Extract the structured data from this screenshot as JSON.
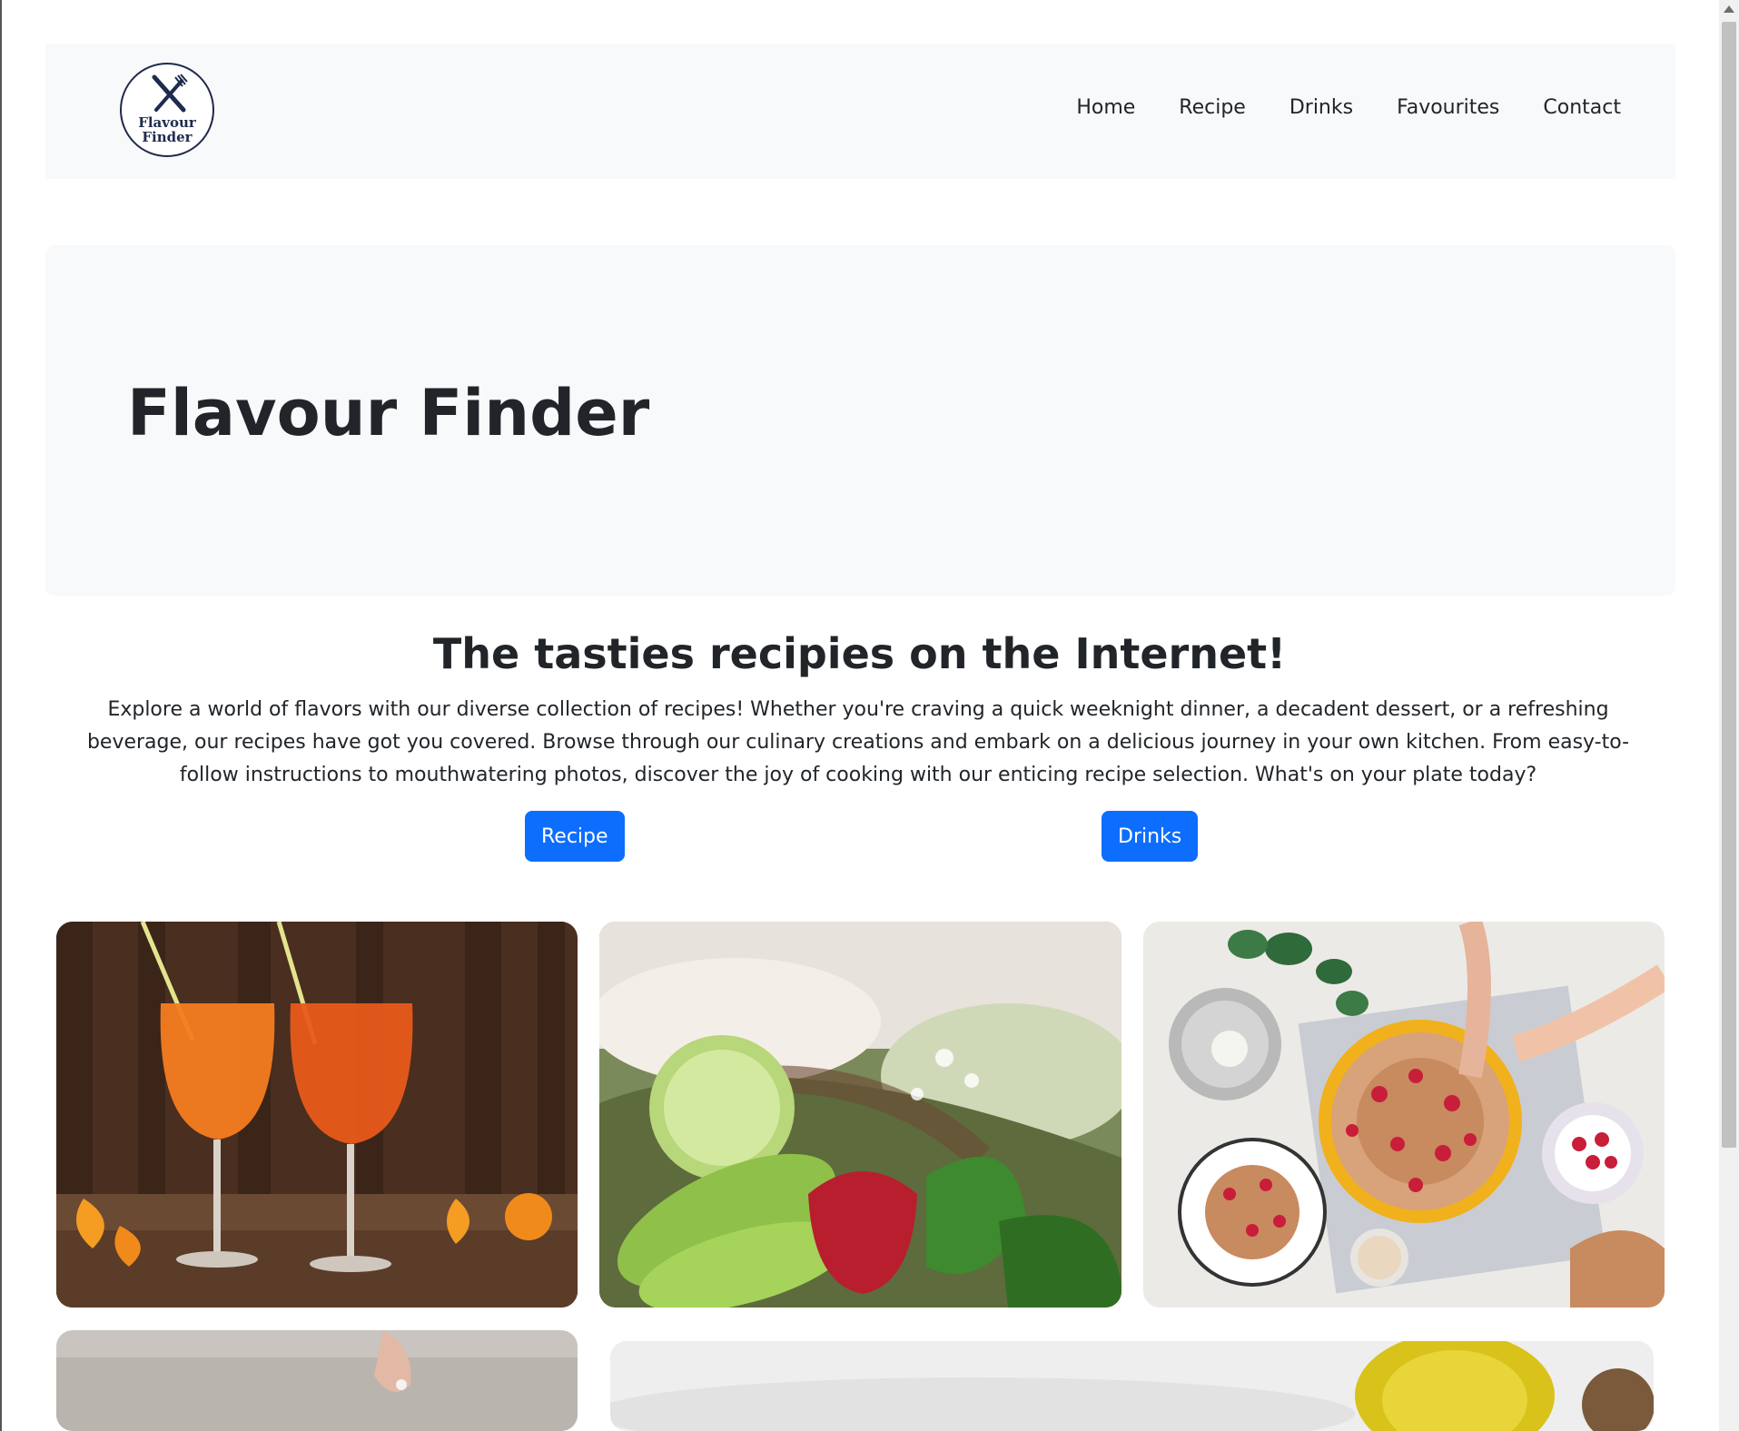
{
  "navbar": {
    "logo_line1": "Flavour",
    "logo_line2": "Finder",
    "links": [
      {
        "label": "Home"
      },
      {
        "label": "Recipe"
      },
      {
        "label": "Drinks"
      },
      {
        "label": "Favourites"
      },
      {
        "label": "Contact"
      }
    ]
  },
  "hero": {
    "title": "Flavour Finder"
  },
  "intro": {
    "heading": "The tasties recipies on the Internet!",
    "text": "Explore a world of flavors with our diverse collection of recipes! Whether you're craving a quick weeknight dinner, a decadent dessert, or a refreshing beverage, our recipes have got you covered. Browse through our culinary creations and embark on a delicious journey in your own kitchen. From easy-to-follow instructions to mouthwatering photos, discover the joy of cooking with our enticing recipe selection. What's on your plate today?",
    "recipe_button": "Recipe",
    "drinks_button": "Drinks"
  },
  "colors": {
    "primary_button": "#0d6efd",
    "navbar_bg": "#f8f9fa",
    "logo_navy": "#1f2b4d"
  }
}
